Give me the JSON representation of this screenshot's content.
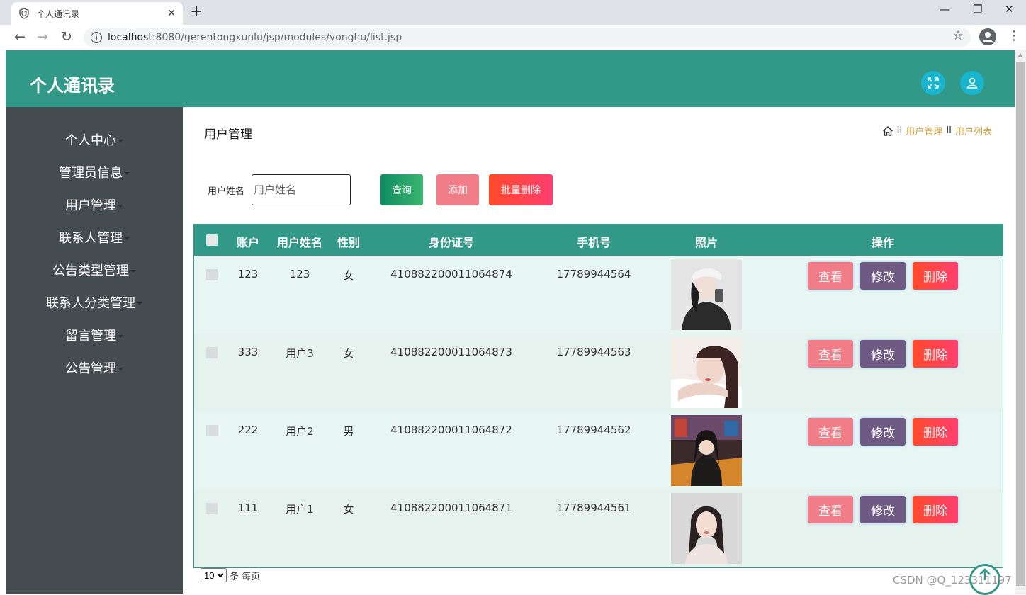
{
  "browser": {
    "tab_title": "个人通讯录",
    "url_host": "localhost",
    "url_rest": ":8080/gerentongxunlu/jsp/modules/yonghu/list.jsp"
  },
  "app": {
    "brand": "个人通讯录"
  },
  "sidebar": {
    "items": [
      {
        "label": "个人中心"
      },
      {
        "label": "管理员信息"
      },
      {
        "label": "用户管理"
      },
      {
        "label": "联系人管理"
      },
      {
        "label": "公告类型管理"
      },
      {
        "label": "联系人分类管理"
      },
      {
        "label": "留言管理"
      },
      {
        "label": "公告管理"
      }
    ]
  },
  "page": {
    "title": "用户管理",
    "breadcrumb": {
      "sep": "II",
      "level1": "用户管理",
      "level2": "用户列表"
    }
  },
  "search": {
    "label": "用户姓名",
    "placeholder": "用户姓名",
    "query_label": "查询",
    "add_label": "添加",
    "batch_delete_label": "批量删除"
  },
  "table": {
    "headers": {
      "account": "账户",
      "name": "用户姓名",
      "gender": "性别",
      "id_number": "身份证号",
      "phone": "手机号",
      "photo": "照片",
      "actions": "操作"
    },
    "rows": [
      {
        "account": "123",
        "name": "123",
        "gender": "女",
        "id_number": "410882200011064874",
        "phone": "17789944564"
      },
      {
        "account": "333",
        "name": "用户3",
        "gender": "女",
        "id_number": "410882200011064873",
        "phone": "17789944563"
      },
      {
        "account": "222",
        "name": "用户2",
        "gender": "男",
        "id_number": "410882200011064872",
        "phone": "17789944562"
      },
      {
        "account": "111",
        "name": "用户1",
        "gender": "女",
        "id_number": "410882200011064871",
        "phone": "17789944561"
      }
    ],
    "action_labels": {
      "view": "查看",
      "edit": "修改",
      "delete": "删除"
    }
  },
  "pager": {
    "page_size": "10",
    "suffix": "条 每页"
  },
  "watermark": "CSDN @Q_123311197"
}
